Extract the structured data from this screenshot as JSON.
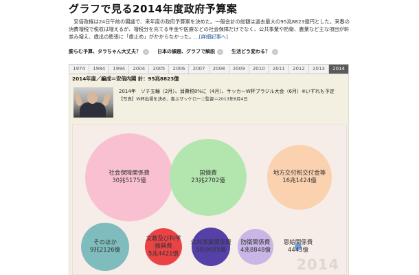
{
  "header": {
    "title": "グラフで見る2014年度政府予算案",
    "intro": "安倍政権は24日午前の閣議で、来年度の政府予算案を決めた。一般会計の総額は過去最大の95兆8823億円とした。来春の消費増税で税収は増えるが、増税分を充てる年金や医療などの社会保障だけでなく、公共事業や防衛、農業など主な項目が軒並み増え、歳出の膨張に「歯止め」がかからなかった。…",
    "more_link": "[詳細記事へ]"
  },
  "links": [
    {
      "label": "膨らむ予算、タラちゃん大丈夫？"
    },
    {
      "label": "日本の課題、グラフで解説"
    },
    {
      "label": "生活どう変わる？"
    }
  ],
  "years": [
    "1974",
    "1984",
    "1994",
    "2004",
    "2005",
    "2006",
    "2007",
    "2008",
    "2009",
    "2010",
    "2011",
    "2012",
    "2013",
    "2014"
  ],
  "selected_year": "2014",
  "panel": {
    "summary": "2014年度／編成＝安倍内閣 計：95兆8823億",
    "events": "2014年　ソチ五輪（2月）、消費税8%に（4月）、サッカーW杯ブラジル大会（6月）※いずれも予定",
    "caption": "【写真】W杯出場を決め、喜ぶザッケローニ監督＝2013年6月4日"
  },
  "chart_data": {
    "type": "bubble",
    "watermark": "2014",
    "items": [
      {
        "name": "社会保障関係費",
        "value": "30兆5175億",
        "amount": 305175,
        "color": "#f9c0d1"
      },
      {
        "name": "国債費",
        "value": "23兆2702億",
        "amount": 232702,
        "color": "#b3e6ae"
      },
      {
        "name": "地方交付税交付金等",
        "value": "16兆1424億",
        "amount": 161424,
        "color": "#fbd2b0"
      },
      {
        "name": "そのほか",
        "value": "9兆2126億",
        "amount": 92126,
        "color": "#7fbcbd"
      },
      {
        "name": "文教及び科学振興費",
        "value": "5兆4421億",
        "amount": 54421,
        "color": "#ea4346"
      },
      {
        "name": "公共事業関係費",
        "value": "5兆9685億",
        "amount": 59685,
        "color": "#5540a8"
      },
      {
        "name": "防衛関係費",
        "value": "4兆8848億",
        "amount": 48848,
        "color": "#c9b6e6"
      },
      {
        "name": "恩給関係費",
        "value": "4443億",
        "amount": 4443,
        "color": "#6aa1dd"
      }
    ]
  }
}
